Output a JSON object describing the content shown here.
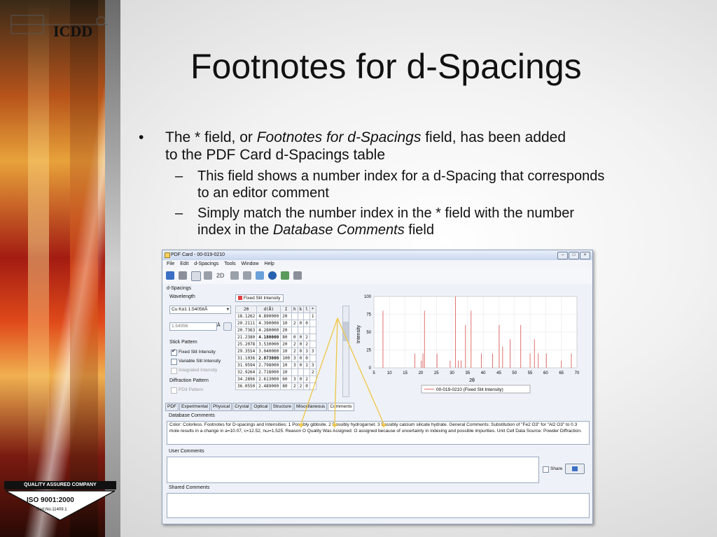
{
  "slide": {
    "title": "Footnotes for d-Spacings",
    "bullet_pre": "The * field, or ",
    "bullet_em": "Footnotes for d-Spacings",
    "bullet_post1": " field, has been added",
    "bullet_line2": "to the PDF Card d-Spacings table",
    "sub1_line1": "This field shows a number index for a d-Spacing that corresponds",
    "sub1_line2": "to an editor comment",
    "sub2_line1": "Simply match the number index in the * field with the number",
    "sub2_pre": "index in the ",
    "sub2_em": "Database Comments",
    "sub2_post": " field",
    "dash": "–",
    "bullet_mark": "•"
  },
  "branding": {
    "logo": "ICDD",
    "quality": "QUALITY ASSURED COMPANY",
    "iso": "ISO 9001:2000",
    "cert": "Cert.No.11409.1"
  },
  "window": {
    "title": "PDF Card - 00-019-0210",
    "menu": [
      "File",
      "Edit",
      "d-Spacings",
      "Tools",
      "Window",
      "Help"
    ],
    "toolbar_2d": "2D",
    "dspacings_label": "d-Spacings",
    "wavelength_label": "Wavelength",
    "wavelength_select": "Cu Kα1 1.54056Å",
    "wavelength_value": "1.54056",
    "unit": "Å",
    "stick_label": "Stick Pattern",
    "fixed_slit": "Fixed Slit Intensity",
    "variable_slit": "Variable Slit Intensity",
    "integrated": "Integrated Intensity",
    "diffraction_label": "Diffraction Pattern",
    "pd3": "PD3 Pattern",
    "table_tab": "Fixed Slit Intensity",
    "table_headers": [
      "2θ",
      "d(Å)",
      "I",
      "h",
      "k",
      "l",
      "*"
    ],
    "table_rows": [
      [
        "18.1262",
        "4.890000",
        "20",
        "",
        "",
        "",
        "1"
      ],
      [
        "20.2111",
        "4.390000",
        "10",
        "2",
        "0",
        "0",
        ""
      ],
      [
        "20.7363",
        "4.280000",
        "20",
        "",
        "",
        "",
        ""
      ],
      [
        "21.2380",
        "4.180000",
        "80",
        "0",
        "0",
        "2",
        ""
      ],
      [
        "25.2078",
        "3.530000",
        "20",
        "2",
        "0",
        "2",
        ""
      ],
      [
        "29.3554",
        "3.040000",
        "10",
        "2",
        "0",
        "3",
        "3"
      ],
      [
        "31.1036",
        "2.873000",
        "100",
        "3",
        "0",
        "0",
        ""
      ],
      [
        "31.9594",
        "2.798000",
        "10",
        "3",
        "0",
        "1",
        "3"
      ],
      [
        "32.9264",
        "2.718000",
        "10",
        "",
        "",
        "",
        "2"
      ],
      [
        "34.2896",
        "2.613000",
        "60",
        "3",
        "0",
        "2",
        ""
      ],
      [
        "36.0550",
        "2.489000",
        "80",
        "2",
        "2",
        "0",
        ""
      ]
    ],
    "tabs": [
      "PDF",
      "Experimental",
      "Physical",
      "Crystal",
      "Optical",
      "Structure",
      "Miscellaneous",
      "Comments"
    ],
    "db_comments_label": "Database Comments",
    "db_comments_text": "Color: Colorless. Footnotes for D-spacings and Intensities: 1 Possibly gibbsite. 2 Possibly hydrogarnet. 3 Possibly calcium silicate hydrate. General Comments: Substitution of \"Fe2 O3\" for \"Al2 O3\" to 0.3 mole results in a change in a=10.07, c=12.52, nω=1.525. Reason O Quality Was Assigned: O assigned because of uncertainty in indexing and possible impurities. Unit Cell Data Source: Powder Diffraction.",
    "user_comments_label": "User Comments",
    "share_label": "Share",
    "shared_comments_label": "Shared Comments"
  },
  "chart_data": {
    "type": "bar",
    "xlabel": "2θ",
    "ylabel": "Intensity",
    "xlim": [
      5,
      70
    ],
    "ylim": [
      0,
      100
    ],
    "xticks": [
      5,
      10,
      15,
      20,
      25,
      30,
      35,
      40,
      45,
      50,
      55,
      60,
      65,
      70
    ],
    "yticks": [
      0,
      25,
      50,
      75,
      100
    ],
    "legend": "00-019-0210 (Fixed Slit Intensity)",
    "color": "#e07070",
    "x": [
      7.9,
      18.1,
      20.2,
      20.7,
      21.2,
      25.2,
      29.4,
      31.1,
      32.0,
      32.9,
      34.3,
      36.1,
      39.4,
      43.0,
      45.1,
      46.2,
      48.6,
      52.0,
      55.0,
      56.4,
      57.6,
      60.2,
      65.0,
      68.2
    ],
    "values": [
      80,
      20,
      10,
      20,
      80,
      20,
      10,
      100,
      10,
      10,
      60,
      80,
      20,
      20,
      60,
      30,
      40,
      60,
      20,
      40,
      20,
      20,
      10,
      20
    ]
  }
}
